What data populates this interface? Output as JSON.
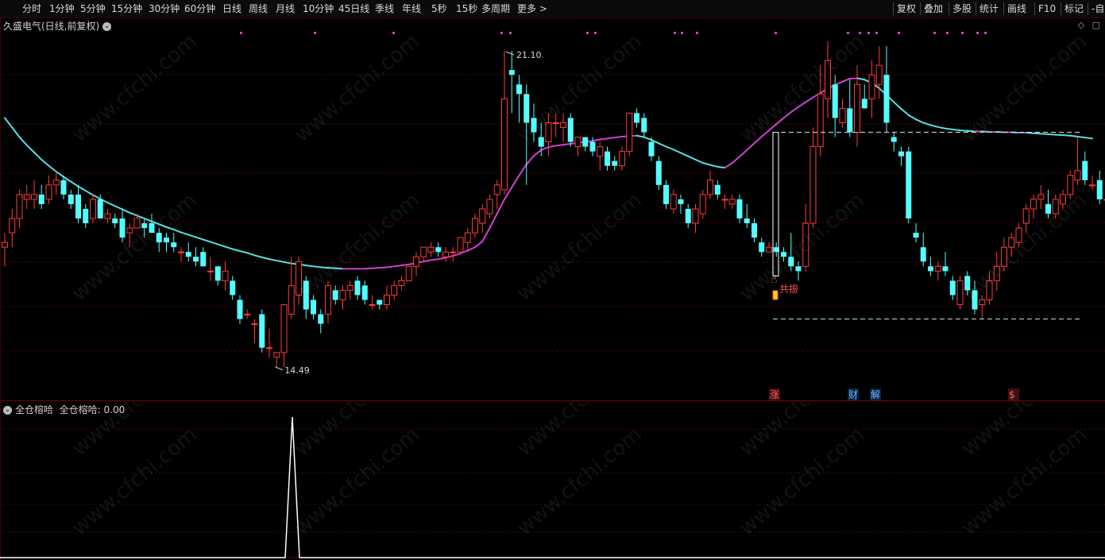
{
  "toolbar": {
    "periods": [
      "分时",
      "1分钟",
      "5分钟",
      "15分钟",
      "30分钟",
      "60分钟",
      "日线",
      "周线",
      "月线",
      "10分钟",
      "45日线",
      "季线",
      "年线",
      "5秒",
      "15秒",
      "多周期",
      "更多 >"
    ],
    "tools": [
      "复权",
      "叠加",
      "多股",
      "统计",
      "画线",
      "F10",
      "标记",
      "-自"
    ]
  },
  "chart": {
    "title": "久盛电气(日线,前复权)",
    "title_icon": "chevron-down-icon",
    "high_label": "21.10",
    "low_label": "14.49",
    "annotation": "共振",
    "event_markers": [
      "涨",
      "财",
      "解",
      "$"
    ],
    "colors": {
      "up": "#ff3b3b",
      "down": "#54ffff",
      "ma_up": "#d040d0",
      "ma_down": "#54e0e0",
      "dots": "#d040d0",
      "grid": "#5a0000"
    }
  },
  "indicator": {
    "title": "全仓榕哈",
    "value_label": "全仓榕哈: 0.00",
    "line_color": "#ffffff"
  },
  "chart_data": {
    "type": "candlestick",
    "candles": [
      [
        17.0,
        17.3,
        16.6,
        17.1
      ],
      [
        17.3,
        17.8,
        17.0,
        17.6
      ],
      [
        17.6,
        18.2,
        17.4,
        18.1
      ],
      [
        18.0,
        18.3,
        17.8,
        18.1
      ],
      [
        18.0,
        18.4,
        17.8,
        18.1
      ],
      [
        18.1,
        18.3,
        17.8,
        17.9
      ],
      [
        18.0,
        18.5,
        17.9,
        18.3
      ],
      [
        18.3,
        18.6,
        18.1,
        18.4
      ],
      [
        18.4,
        18.5,
        18.0,
        18.1
      ],
      [
        18.1,
        18.2,
        17.8,
        17.9
      ],
      [
        18.1,
        18.3,
        17.5,
        17.6
      ],
      [
        17.8,
        17.9,
        17.4,
        17.5
      ],
      [
        17.6,
        18.1,
        17.5,
        18.0
      ],
      [
        18.0,
        18.1,
        17.6,
        17.6
      ],
      [
        17.6,
        17.8,
        17.5,
        17.7
      ],
      [
        17.6,
        17.7,
        17.4,
        17.5
      ],
      [
        17.6,
        17.8,
        17.1,
        17.2
      ],
      [
        17.3,
        17.5,
        17.0,
        17.4
      ],
      [
        17.4,
        17.7,
        17.4,
        17.6
      ],
      [
        17.5,
        17.6,
        17.2,
        17.4
      ],
      [
        17.5,
        17.7,
        17.3,
        17.3
      ],
      [
        17.3,
        17.4,
        16.9,
        17.1
      ],
      [
        17.2,
        17.3,
        16.9,
        17.1
      ],
      [
        17.1,
        17.3,
        16.9,
        17.0
      ],
      [
        16.9,
        17.0,
        16.7,
        16.9
      ],
      [
        16.9,
        17.1,
        16.7,
        16.8
      ],
      [
        16.8,
        17.0,
        16.6,
        16.7
      ],
      [
        16.9,
        17.0,
        16.6,
        16.6
      ],
      [
        16.5,
        16.8,
        16.3,
        16.5
      ],
      [
        16.6,
        16.6,
        16.2,
        16.3
      ],
      [
        16.3,
        16.7,
        16.1,
        16.5
      ],
      [
        16.3,
        16.4,
        15.9,
        16.0
      ],
      [
        15.9,
        16.0,
        15.4,
        15.5
      ],
      [
        15.6,
        15.7,
        15.5,
        15.6
      ],
      [
        15.4,
        15.5,
        15.0,
        15.4
      ],
      [
        15.6,
        15.7,
        14.8,
        14.9
      ],
      [
        14.9,
        15.3,
        14.7,
        14.9
      ],
      [
        14.7,
        14.8,
        14.5,
        14.8
      ],
      [
        14.8,
        15.8,
        14.5,
        15.8
      ],
      [
        15.6,
        16.8,
        15.5,
        16.2
      ],
      [
        16.0,
        16.8,
        15.8,
        16.7
      ],
      [
        16.3,
        16.4,
        15.5,
        15.7
      ],
      [
        15.9,
        16.0,
        15.5,
        15.6
      ],
      [
        15.6,
        15.7,
        15.2,
        15.4
      ],
      [
        15.6,
        16.3,
        15.4,
        16.2
      ],
      [
        16.1,
        16.2,
        15.8,
        15.9
      ],
      [
        15.9,
        16.2,
        15.7,
        16.1
      ],
      [
        16.1,
        16.3,
        15.9,
        16.2
      ],
      [
        16.3,
        16.4,
        15.9,
        16.0
      ],
      [
        16.2,
        16.3,
        15.8,
        15.9
      ],
      [
        15.8,
        16.0,
        15.7,
        15.8
      ],
      [
        15.9,
        15.9,
        15.7,
        15.8
      ],
      [
        15.8,
        16.2,
        15.7,
        16.0
      ],
      [
        16.0,
        16.3,
        15.9,
        16.2
      ],
      [
        16.2,
        16.4,
        16.1,
        16.3
      ],
      [
        16.3,
        16.6,
        16.3,
        16.6
      ],
      [
        16.6,
        16.9,
        16.4,
        16.8
      ],
      [
        16.8,
        17.0,
        16.7,
        17.0
      ],
      [
        16.9,
        17.1,
        16.8,
        17.0
      ],
      [
        17.0,
        17.1,
        16.8,
        16.9
      ],
      [
        16.8,
        17.0,
        16.7,
        16.9
      ],
      [
        16.9,
        17.0,
        16.7,
        16.9
      ],
      [
        16.9,
        17.2,
        16.9,
        17.2
      ],
      [
        17.1,
        17.4,
        16.9,
        17.3
      ],
      [
        17.3,
        17.7,
        17.2,
        17.6
      ],
      [
        17.5,
        17.9,
        17.3,
        17.8
      ],
      [
        17.7,
        18.1,
        17.6,
        18.0
      ],
      [
        18.1,
        18.4,
        17.8,
        18.3
      ],
      [
        18.2,
        21.1,
        18.1,
        20.1
      ],
      [
        20.7,
        21.1,
        19.8,
        20.6
      ],
      [
        20.4,
        20.6,
        19.6,
        20.2
      ],
      [
        20.2,
        20.4,
        18.3,
        19.6
      ],
      [
        19.7,
        20.0,
        19.2,
        19.4
      ],
      [
        19.3,
        19.6,
        18.9,
        19.1
      ],
      [
        19.2,
        19.8,
        18.9,
        19.6
      ],
      [
        19.6,
        19.8,
        19.3,
        19.6
      ],
      [
        19.5,
        19.8,
        19.2,
        19.6
      ],
      [
        19.7,
        19.8,
        19.1,
        19.2
      ],
      [
        19.1,
        19.3,
        18.9,
        19.3
      ],
      [
        19.3,
        19.3,
        19.0,
        19.1
      ],
      [
        19.2,
        19.3,
        18.9,
        19.0
      ],
      [
        18.9,
        19.2,
        18.6,
        19.1
      ],
      [
        19.0,
        19.1,
        18.6,
        18.7
      ],
      [
        18.8,
        18.9,
        18.6,
        18.7
      ],
      [
        18.7,
        19.1,
        18.6,
        19.0
      ],
      [
        19.0,
        19.8,
        18.9,
        19.8
      ],
      [
        19.8,
        19.9,
        19.5,
        19.6
      ],
      [
        19.7,
        19.8,
        19.3,
        19.4
      ],
      [
        19.2,
        19.3,
        18.8,
        18.9
      ],
      [
        18.8,
        18.9,
        18.2,
        18.3
      ],
      [
        18.3,
        18.4,
        17.8,
        17.9
      ],
      [
        17.8,
        18.2,
        17.7,
        18.1
      ],
      [
        18.0,
        18.1,
        17.7,
        17.9
      ],
      [
        17.8,
        17.9,
        17.4,
        17.5
      ],
      [
        17.5,
        17.9,
        17.3,
        17.8
      ],
      [
        17.7,
        18.2,
        17.6,
        18.1
      ],
      [
        18.1,
        18.6,
        18.0,
        18.4
      ],
      [
        18.3,
        18.4,
        18.0,
        18.1
      ],
      [
        18.0,
        18.1,
        17.8,
        18.0
      ],
      [
        17.9,
        18.1,
        17.8,
        18.0
      ],
      [
        18.0,
        18.1,
        17.5,
        17.6
      ],
      [
        17.6,
        17.9,
        17.4,
        17.5
      ],
      [
        17.5,
        17.6,
        17.1,
        17.2
      ],
      [
        17.1,
        17.2,
        16.8,
        16.9
      ],
      [
        16.9,
        17.1,
        16.9,
        17.0
      ],
      [
        17.0,
        17.1,
        16.8,
        16.9
      ],
      [
        16.9,
        17.0,
        16.7,
        16.8
      ],
      [
        16.8,
        17.3,
        16.5,
        16.6
      ],
      [
        16.6,
        16.7,
        16.3,
        16.5
      ],
      [
        16.6,
        17.9,
        16.5,
        17.5
      ],
      [
        17.5,
        19.5,
        17.4,
        19.1
      ],
      [
        19.1,
        20.8,
        18.9,
        20.2
      ],
      [
        20.1,
        21.3,
        19.7,
        20.9
      ],
      [
        20.4,
        20.6,
        19.3,
        19.7
      ],
      [
        19.6,
        20.1,
        19.5,
        19.9
      ],
      [
        19.9,
        20.5,
        19.3,
        19.4
      ],
      [
        19.4,
        20.8,
        19.1,
        20.4
      ],
      [
        20.1,
        20.4,
        19.9,
        19.9
      ],
      [
        20.1,
        20.9,
        19.7,
        20.6
      ],
      [
        20.4,
        21.2,
        20.1,
        20.8
      ],
      [
        20.6,
        21.2,
        19.4,
        19.6
      ],
      [
        19.3,
        19.4,
        19.0,
        19.2
      ],
      [
        19.0,
        19.1,
        18.7,
        18.9
      ],
      [
        19.0,
        19.1,
        17.5,
        17.6
      ],
      [
        17.3,
        17.5,
        17.1,
        17.2
      ],
      [
        17.0,
        17.3,
        16.6,
        16.7
      ],
      [
        16.6,
        16.8,
        16.4,
        16.5
      ],
      [
        16.5,
        16.7,
        16.3,
        16.6
      ],
      [
        16.6,
        16.9,
        16.4,
        16.5
      ],
      [
        16.3,
        16.4,
        15.9,
        16.0
      ],
      [
        15.8,
        16.4,
        15.7,
        16.3
      ],
      [
        16.4,
        16.5,
        16.0,
        16.1
      ],
      [
        16.1,
        16.3,
        15.6,
        15.7
      ],
      [
        15.8,
        16.0,
        15.5,
        15.9
      ],
      [
        15.9,
        16.5,
        15.8,
        16.3
      ],
      [
        16.3,
        16.9,
        16.1,
        16.6
      ],
      [
        16.6,
        17.2,
        16.5,
        17.0
      ],
      [
        17.0,
        17.3,
        16.8,
        17.2
      ],
      [
        17.1,
        17.5,
        17.0,
        17.4
      ],
      [
        17.5,
        17.9,
        17.3,
        17.8
      ],
      [
        17.8,
        18.1,
        17.6,
        18.0
      ],
      [
        18.0,
        18.3,
        17.8,
        18.1
      ],
      [
        17.9,
        18.2,
        17.6,
        17.7
      ],
      [
        17.7,
        18.1,
        17.6,
        18.0
      ],
      [
        17.9,
        18.2,
        17.8,
        18.1
      ],
      [
        18.1,
        18.6,
        18.0,
        18.5
      ],
      [
        18.4,
        19.3,
        18.3,
        18.6
      ],
      [
        18.8,
        19.0,
        18.3,
        18.4
      ],
      [
        18.3,
        18.5,
        18.2,
        18.3
      ],
      [
        18.4,
        18.6,
        17.9,
        18.0
      ],
      [
        18.0,
        18.1,
        17.9,
        18.0
      ],
      [
        17.9,
        18.2,
        17.8,
        18.0
      ],
      [
        18.0,
        18.1,
        17.5,
        17.6
      ],
      [
        17.6,
        17.7,
        17.3,
        17.4
      ]
    ],
    "ma": [
      19.7,
      19.5,
      19.3,
      19.13,
      18.98,
      18.83,
      18.7,
      18.58,
      18.47,
      18.37,
      18.27,
      18.18,
      18.09,
      18.01,
      17.93,
      17.86,
      17.79,
      17.72,
      17.66,
      17.6,
      17.54,
      17.48,
      17.42,
      17.37,
      17.31,
      17.26,
      17.21,
      17.16,
      17.11,
      17.06,
      17.01,
      16.96,
      16.92,
      16.88,
      16.83,
      16.79,
      16.75,
      16.72,
      16.69,
      16.66,
      16.64,
      16.62,
      16.6,
      16.58,
      16.57,
      16.56,
      16.55,
      16.55,
      16.55,
      16.55,
      16.56,
      16.57,
      16.58,
      16.6,
      16.62,
      16.64,
      16.67,
      16.7,
      16.73,
      16.75,
      16.78,
      16.82,
      16.87,
      16.93,
      17.0,
      17.12,
      17.4,
      17.7,
      18.0,
      18.25,
      18.5,
      18.73,
      18.91,
      19.03,
      19.09,
      19.12,
      19.14,
      19.16,
      19.18,
      19.2,
      19.22,
      19.25,
      19.27,
      19.29,
      19.31,
      19.32,
      19.33,
      19.3,
      19.24,
      19.17,
      19.1,
      19.04,
      18.97,
      18.9,
      18.83,
      18.76,
      18.72,
      18.68,
      18.66,
      18.76,
      18.89,
      19.03,
      19.17,
      19.31,
      19.44,
      19.57,
      19.7,
      19.82,
      19.93,
      20.03,
      20.13,
      20.22,
      20.31,
      20.39,
      20.46,
      20.52,
      20.53,
      20.5,
      20.43,
      20.32,
      20.18,
      20.03,
      19.89,
      19.76,
      19.67,
      19.6,
      19.55,
      19.51,
      19.48,
      19.46,
      19.44,
      19.43,
      19.42,
      19.42,
      19.41,
      19.41,
      19.4,
      19.4,
      19.39,
      19.39,
      19.38,
      19.37,
      19.36,
      19.35,
      19.34,
      19.33,
      19.31,
      19.29,
      19.27
    ],
    "ylim": [
      14.0,
      21.5
    ],
    "support_level": 15.5,
    "resistance_level": 19.4,
    "indicator_values_spike": 1,
    "indicator_value_current": 0.0
  }
}
